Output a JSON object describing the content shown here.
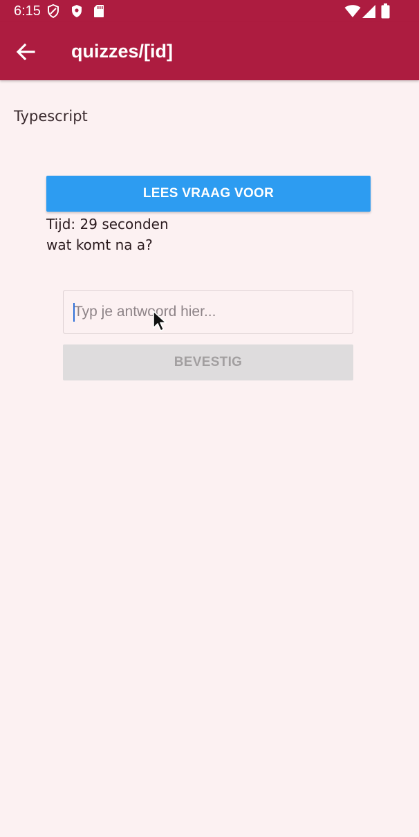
{
  "status_bar": {
    "time": "6:15",
    "left_icons": [
      "shield-outline-icon",
      "shield-filled-icon",
      "sd-card-icon"
    ],
    "right_icons": [
      "wifi-icon",
      "signal-icon",
      "battery-icon"
    ]
  },
  "app_bar": {
    "title": "quizzes/[id]",
    "back_icon": "arrow-left-icon"
  },
  "quiz": {
    "category": "Typescript",
    "read_button_label": "LEES VRAAG VOOR",
    "timer_text": "Tijd: 29 seconden",
    "question_text": "wat komt na a?",
    "answer_placeholder": "Typ je antwoord hier...",
    "answer_value": "",
    "confirm_button_label": "BEVESTIG",
    "confirm_enabled": false
  },
  "colors": {
    "primary": "#ad1c40",
    "accent_button": "#2d9cf1",
    "background": "#fcf1f2",
    "disabled_button": "#dedcdd"
  }
}
